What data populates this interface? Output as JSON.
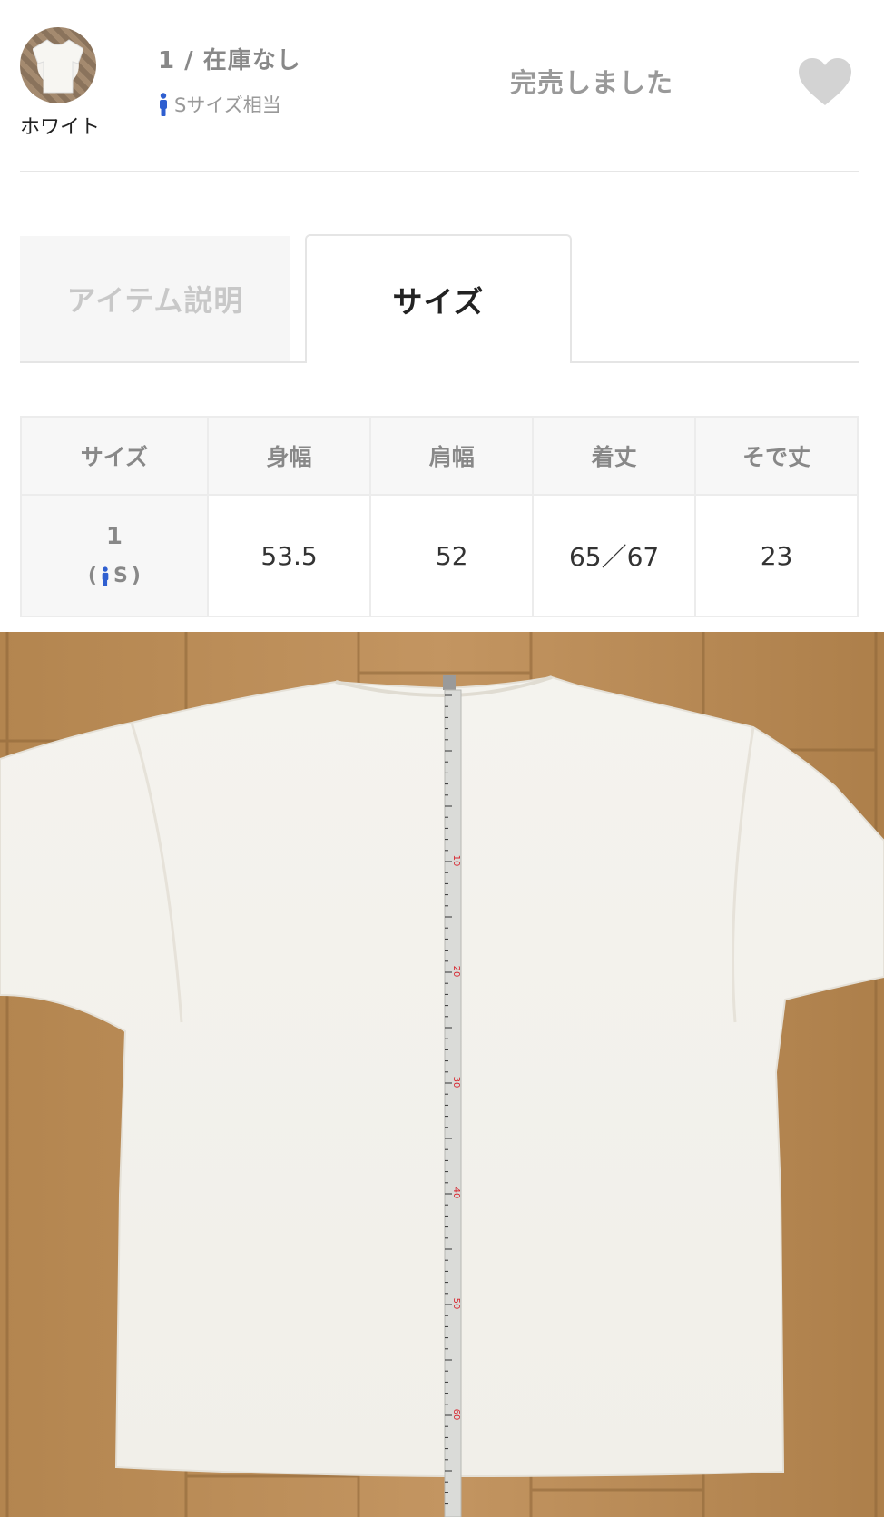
{
  "variant": {
    "color_label": "ホワイト",
    "size_stock": "1 / 在庫なし",
    "size_equiv": "Sサイズ相当",
    "status": "完売しました",
    "favorite_icon": "heart-icon"
  },
  "tabs": [
    {
      "label": "アイテム説明",
      "active": false
    },
    {
      "label": "サイズ",
      "active": true
    }
  ],
  "size_table": {
    "headers": [
      "サイズ",
      "身幅",
      "肩幅",
      "着丈",
      "そで丈"
    ],
    "rows": [
      {
        "size": "1",
        "size_equiv": "S",
        "values": [
          "53.5",
          "52",
          "65／67",
          "23"
        ]
      }
    ]
  },
  "photo": {
    "subject": "white-shirt-with-measuring-tape",
    "tape_marks": [
      "10",
      "20",
      "30",
      "40",
      "50",
      "60"
    ]
  },
  "colors": {
    "accent_icon": "#2f5fd0",
    "tape_red": "#d7262f",
    "floor": "#b88a55"
  }
}
